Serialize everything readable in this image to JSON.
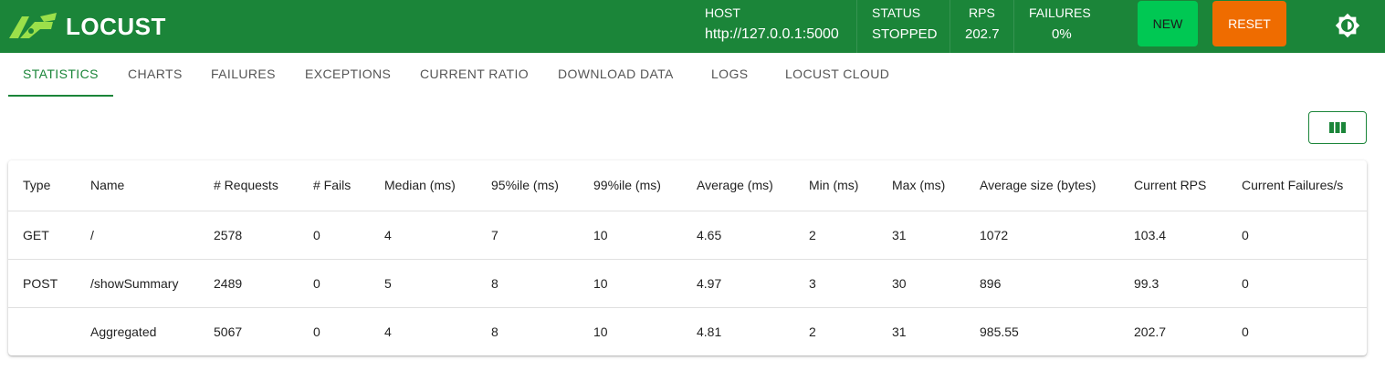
{
  "app": {
    "logo_text": "LOCUST"
  },
  "header": {
    "host": {
      "label": "HOST",
      "value": "http://127.0.0.1:5000"
    },
    "status": {
      "label": "STATUS",
      "value": "STOPPED"
    },
    "rps": {
      "label": "RPS",
      "value": "202.7"
    },
    "failures": {
      "label": "FAILURES",
      "value": "0%"
    },
    "new_label": "NEW",
    "reset_label": "RESET",
    "theme_icon": "brightness-icon"
  },
  "tabs": [
    {
      "label": "STATISTICS",
      "active": true
    },
    {
      "label": "CHARTS"
    },
    {
      "label": "FAILURES"
    },
    {
      "label": "EXCEPTIONS"
    },
    {
      "label": "CURRENT RATIO"
    },
    {
      "label": "DOWNLOAD DATA"
    },
    {
      "label": "LOGS"
    },
    {
      "label": "LOCUST CLOUD"
    }
  ],
  "toolbar": {
    "columns_icon": "view-columns-icon"
  },
  "table": {
    "headers": [
      "Type",
      "Name",
      "# Requests",
      "# Fails",
      "Median (ms)",
      "95%ile (ms)",
      "99%ile (ms)",
      "Average (ms)",
      "Min (ms)",
      "Max (ms)",
      "Average size (bytes)",
      "Current RPS",
      "Current Failures/s"
    ],
    "rows": [
      [
        "GET",
        "/",
        "2578",
        "0",
        "4",
        "7",
        "10",
        "4.65",
        "2",
        "31",
        "1072",
        "103.4",
        "0"
      ],
      [
        "POST",
        "/showSummary",
        "2489",
        "0",
        "5",
        "8",
        "10",
        "4.97",
        "3",
        "30",
        "896",
        "99.3",
        "0"
      ],
      [
        "",
        "Aggregated",
        "5067",
        "0",
        "4",
        "8",
        "10",
        "4.81",
        "2",
        "31",
        "985.55",
        "202.7",
        "0"
      ]
    ]
  },
  "colors": {
    "brand": "#1b8539",
    "new": "#00c853",
    "reset": "#ef6c00"
  }
}
